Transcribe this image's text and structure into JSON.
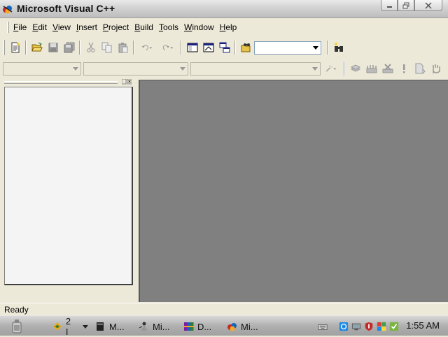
{
  "window": {
    "title": "Microsoft Visual C++"
  },
  "menu": [
    {
      "label": "File",
      "accel": "F",
      "rest": "ile"
    },
    {
      "label": "Edit",
      "accel": "E",
      "rest": "dit"
    },
    {
      "label": "View",
      "accel": "V",
      "rest": "iew"
    },
    {
      "label": "Insert",
      "accel": "I",
      "rest": "nsert"
    },
    {
      "label": "Project",
      "accel": "P",
      "rest": "roject"
    },
    {
      "label": "Build",
      "accel": "B",
      "rest": "uild"
    },
    {
      "label": "Tools",
      "accel": "T",
      "rest": "ools"
    },
    {
      "label": "Window",
      "accel": "W",
      "rest": "indow"
    },
    {
      "label": "Help",
      "accel": "H",
      "rest": "elp"
    }
  ],
  "toolbar": {
    "find_combo_value": "",
    "class_combo_value": "",
    "filter_combo_value": "",
    "members_combo_value": ""
  },
  "status": {
    "text": "Ready"
  },
  "taskbar": {
    "tasks": [
      {
        "label": "2 I",
        "icon": "explorer-icon"
      },
      {
        "label": "M...",
        "icon": "console-icon"
      },
      {
        "label": "Mi...",
        "icon": "paint-icon"
      },
      {
        "label": "D...",
        "icon": "winrar-icon"
      },
      {
        "label": "Mi...",
        "icon": "visual-cpp-icon"
      }
    ],
    "clock": "1:55 AM"
  },
  "colors": {
    "mdi_background": "#808080",
    "chrome": "#ece9d8",
    "titlebar": "#d4d4d4"
  }
}
